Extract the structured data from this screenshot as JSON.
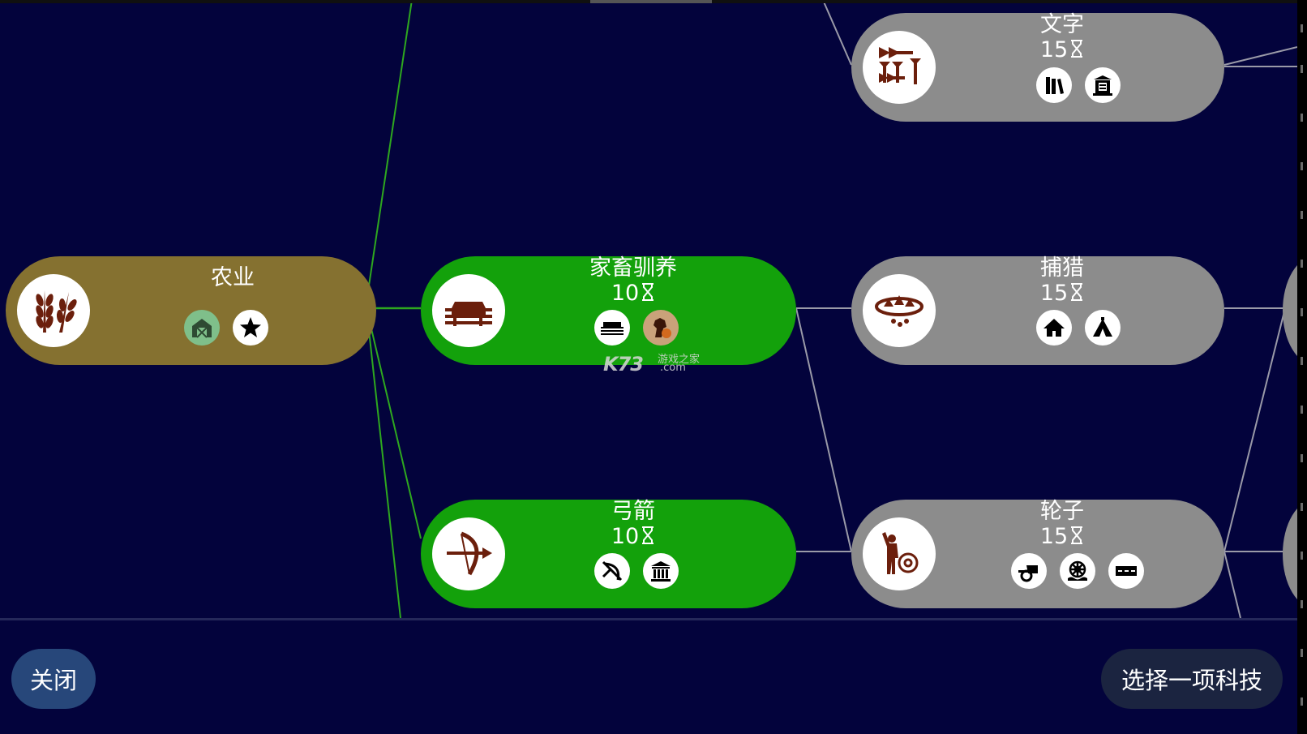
{
  "tech_tree": {
    "techs": [
      {
        "id": "agriculture",
        "name": "农业",
        "cost": "",
        "state": "researched",
        "color": "#857130",
        "icon": "wheat-icon",
        "unlocks": [
          "granary-icon",
          "star-icon"
        ]
      },
      {
        "id": "animal_husbandry",
        "name": "家畜驯养",
        "cost": "10",
        "state": "available",
        "color": "#13a10b",
        "icon": "pasture-icon",
        "unlocks": [
          "pasture-icon",
          "horse-icon"
        ]
      },
      {
        "id": "archery",
        "name": "弓箭",
        "cost": "10",
        "state": "available",
        "color": "#13a10b",
        "icon": "bow-icon",
        "unlocks": [
          "archer-icon",
          "temple-icon"
        ]
      },
      {
        "id": "writing",
        "name": "文字",
        "cost": "15",
        "state": "locked",
        "color": "#8c8c8c",
        "icon": "cuneiform-icon",
        "unlocks": [
          "library-icon",
          "monument-icon"
        ]
      },
      {
        "id": "trapping",
        "name": "捕猎",
        "cost": "15",
        "state": "locked",
        "color": "#8c8c8c",
        "icon": "trap-icon",
        "unlocks": [
          "hut-icon",
          "tent-icon"
        ]
      },
      {
        "id": "wheel",
        "name": "轮子",
        "cost": "15",
        "state": "locked",
        "color": "#8c8c8c",
        "icon": "wheel-maker-icon",
        "unlocks": [
          "chariot-icon",
          "watermill-icon",
          "road-icon"
        ]
      }
    ],
    "cost_icon": "hourglass-icon"
  },
  "watermark": {
    "brand": "K73",
    "sub": "游戏之家",
    "domain": ".com"
  },
  "footer": {
    "close_label": "关闭",
    "select_label": "选择一项科技"
  },
  "colors": {
    "background": "#03033c",
    "researched": "#857130",
    "available": "#13a10b",
    "locked": "#8c8c8c",
    "icon_glyph": "#6b1f0c",
    "line_green": "#2ea81f",
    "line_gray": "#9a9aa8"
  }
}
